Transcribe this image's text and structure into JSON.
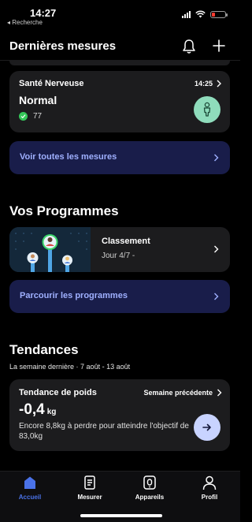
{
  "status_bar": {
    "time": "14:27",
    "back_label": "◂ Recherche"
  },
  "header": {
    "title": "Dernières mesures",
    "icons": [
      "bell-icon",
      "plus-icon"
    ]
  },
  "nerve_card": {
    "title": "Santé Nerveuse",
    "time": "14:25",
    "status": "Normal",
    "value": "77",
    "badge_icon": "person-icon",
    "badge_color": "#8fdcbc",
    "ok_color": "#34c759"
  },
  "all_measures_button": {
    "label": "Voir toutes les mesures"
  },
  "programs": {
    "title": "Vos Programmes",
    "card": {
      "title": "Classement",
      "subtitle": "Jour 4/7 -"
    },
    "browse_label": "Parcourir les programmes"
  },
  "trends": {
    "title": "Tendances",
    "subtitle": "La semaine dernière · 7 août - 13 août",
    "card": {
      "title": "Tendance de poids",
      "period": "Semaine précédente",
      "value": "-0,4",
      "unit": "kg",
      "description": "Encore 8,8kg à perdre pour atteindre l'objectif de 83,0kg"
    }
  },
  "tabbar": {
    "tabs": [
      {
        "label": "Accueil",
        "icon": "home-icon",
        "active": true
      },
      {
        "label": "Mesurer",
        "icon": "measure-icon",
        "active": false
      },
      {
        "label": "Appareils",
        "icon": "devices-icon",
        "active": false
      },
      {
        "label": "Profil",
        "icon": "profile-icon",
        "active": false
      }
    ]
  },
  "colors": {
    "accent": "#4a72e8",
    "button_bg": "#191d4a",
    "button_text": "#9fb0ff",
    "card_bg": "#1c1c1e"
  }
}
